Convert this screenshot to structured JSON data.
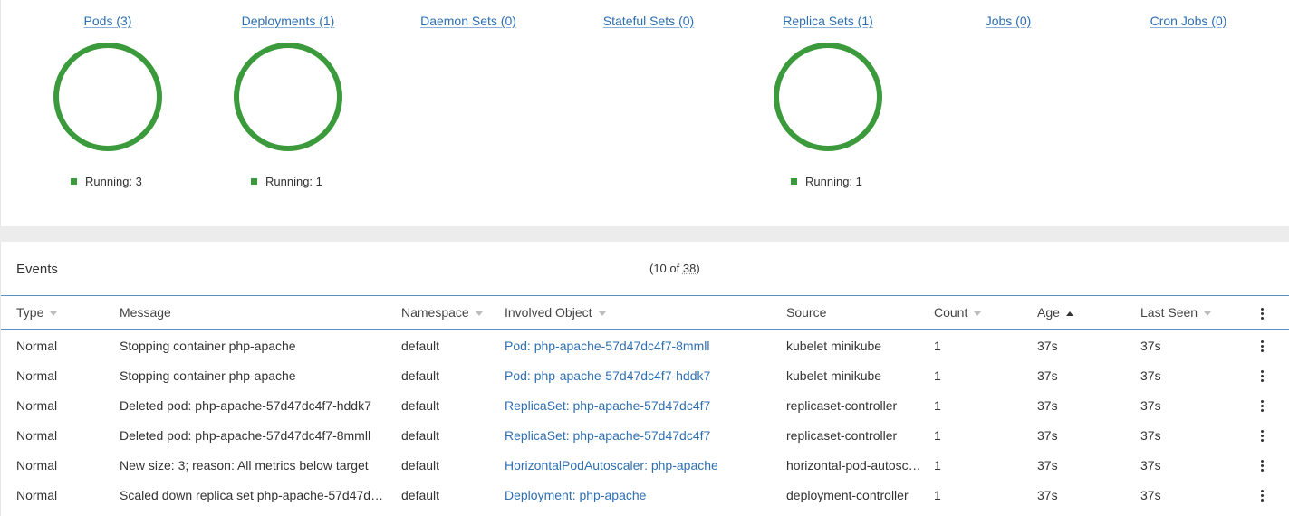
{
  "colors": {
    "running": "#3b9a3b",
    "link": "#2f6fb0",
    "header_border": "#5b8fc8"
  },
  "workloads": [
    {
      "label": "Pods (3)",
      "has_chart": true,
      "legend": "Running: 3"
    },
    {
      "label": "Deployments (1)",
      "has_chart": true,
      "legend": "Running: 1"
    },
    {
      "label": "Daemon Sets (0)",
      "has_chart": false,
      "legend": ""
    },
    {
      "label": "Stateful Sets (0)",
      "has_chart": false,
      "legend": ""
    },
    {
      "label": "Replica Sets (1)",
      "has_chart": true,
      "legend": "Running: 1"
    },
    {
      "label": "Jobs (0)",
      "has_chart": false,
      "legend": ""
    },
    {
      "label": "Cron Jobs (0)",
      "has_chart": false,
      "legend": ""
    }
  ],
  "events": {
    "title": "Events",
    "counter_prefix": "(10 of ",
    "counter_total": "38",
    "counter_suffix": ")",
    "columns": [
      {
        "label": "Type",
        "sort": "none"
      },
      {
        "label": "Message",
        "sort": "hidden"
      },
      {
        "label": "Namespace",
        "sort": "none"
      },
      {
        "label": "Involved Object",
        "sort": "none"
      },
      {
        "label": "Source",
        "sort": "hidden"
      },
      {
        "label": "Count",
        "sort": "none"
      },
      {
        "label": "Age",
        "sort": "asc"
      },
      {
        "label": "Last Seen",
        "sort": "none"
      }
    ],
    "rows": [
      {
        "type": "Normal",
        "message": "Stopping container php-apache",
        "namespace": "default",
        "object": "Pod: php-apache-57d47dc4f7-8mmll",
        "source": "kubelet minikube",
        "count": "1",
        "age": "37s",
        "last_seen": "37s"
      },
      {
        "type": "Normal",
        "message": "Stopping container php-apache",
        "namespace": "default",
        "object": "Pod: php-apache-57d47dc4f7-hddk7",
        "source": "kubelet minikube",
        "count": "1",
        "age": "37s",
        "last_seen": "37s"
      },
      {
        "type": "Normal",
        "message": "Deleted pod: php-apache-57d47dc4f7-hddk7",
        "namespace": "default",
        "object": "ReplicaSet: php-apache-57d47dc4f7",
        "source": "replicaset-controller",
        "count": "1",
        "age": "37s",
        "last_seen": "37s"
      },
      {
        "type": "Normal",
        "message": "Deleted pod: php-apache-57d47dc4f7-8mmll",
        "namespace": "default",
        "object": "ReplicaSet: php-apache-57d47dc4f7",
        "source": "replicaset-controller",
        "count": "1",
        "age": "37s",
        "last_seen": "37s"
      },
      {
        "type": "Normal",
        "message": "New size: 3; reason: All metrics below target",
        "namespace": "default",
        "object": "HorizontalPodAutoscaler: php-apache",
        "source": "horizontal-pod-autosc…",
        "count": "1",
        "age": "37s",
        "last_seen": "37s"
      },
      {
        "type": "Normal",
        "message": "Scaled down replica set php-apache-57d47dc…",
        "namespace": "default",
        "object": "Deployment: php-apache",
        "source": "deployment-controller",
        "count": "1",
        "age": "37s",
        "last_seen": "37s"
      }
    ]
  }
}
